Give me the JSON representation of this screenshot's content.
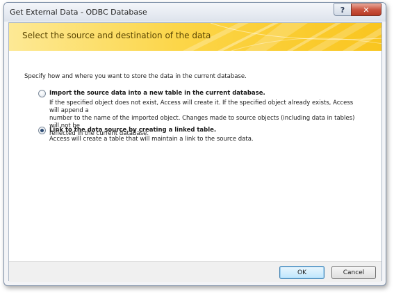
{
  "window": {
    "title": "Get External Data - ODBC Database",
    "help_label": "?",
    "close_label": "✕"
  },
  "banner": {
    "title": "Select the source and destination of the data"
  },
  "intro": "Specify how and where you want to store the data in the current database.",
  "options": [
    {
      "label": "Import the source data into a new table in the current database.",
      "selected": false,
      "description": [
        "If the specified object does not exist, Access will create it. If the specified object already exists, Access will append a",
        "number to the name of the imported object. Changes made to source objects (including data in tables) will not be",
        "reflected in the current database."
      ]
    },
    {
      "label": "Link to the data source by creating a linked table.",
      "selected": true,
      "description": [
        "Access will create a table that will maintain a link to the source data."
      ]
    }
  ],
  "buttons": {
    "ok": "OK",
    "cancel": "Cancel"
  },
  "colors": {
    "banner_text": "#5a4602",
    "banner_gradient_start": "#fde995",
    "banner_gradient_end": "#f9c51f",
    "close_button": "#c9533e"
  }
}
